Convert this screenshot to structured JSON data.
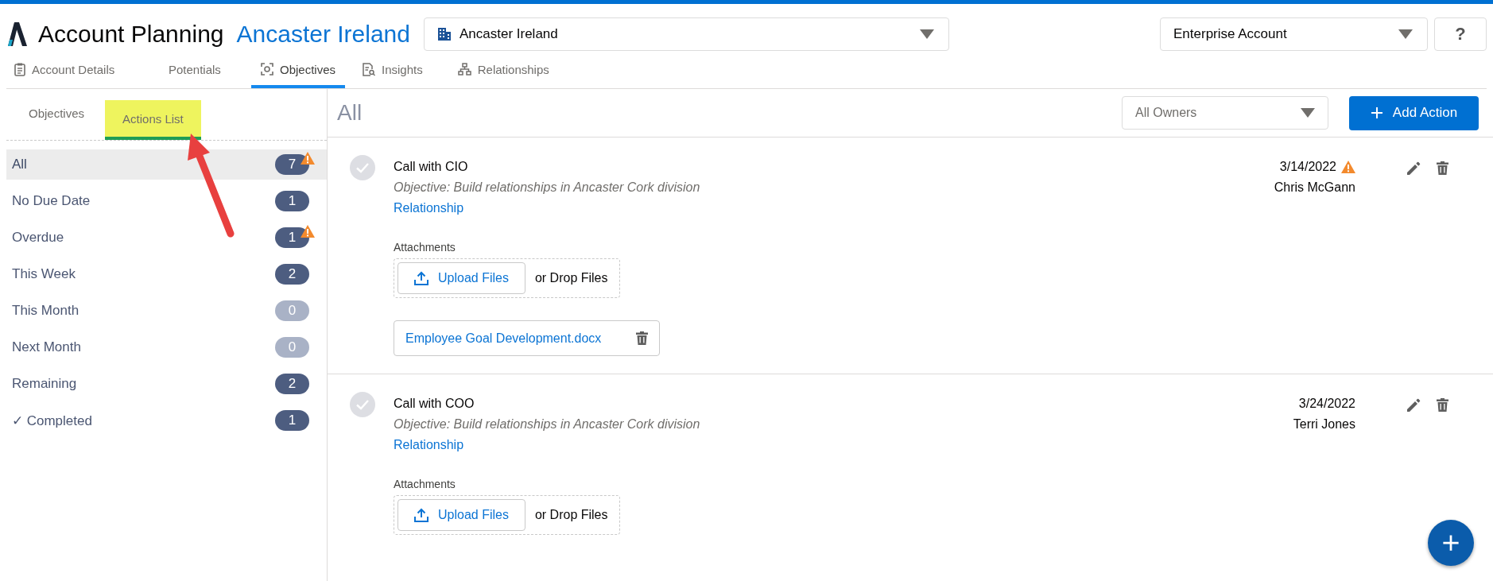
{
  "app": {
    "title": "Account Planning",
    "account": "Ancaster Ireland"
  },
  "account_picker": {
    "value": "Ancaster Ireland"
  },
  "account_type_picker": {
    "value": "Enterprise Account"
  },
  "help_button": {
    "label": "?"
  },
  "tabs": [
    {
      "label": "Account Details",
      "selected": false
    },
    {
      "label": "Potentials",
      "selected": false
    },
    {
      "label": "Objectives",
      "selected": true
    },
    {
      "label": "Insights",
      "selected": false
    },
    {
      "label": "Relationships",
      "selected": false
    }
  ],
  "sub_tabs": [
    {
      "label": "Objectives",
      "selected": false,
      "highlighted": false
    },
    {
      "label": "Actions List",
      "selected": true,
      "highlighted": true
    }
  ],
  "filters": [
    {
      "label": "All",
      "count": "7",
      "selected": true,
      "dimmed": false,
      "warning": true
    },
    {
      "label": "No Due Date",
      "count": "1",
      "selected": false,
      "dimmed": false,
      "warning": false
    },
    {
      "label": "Overdue",
      "count": "1",
      "selected": false,
      "dimmed": false,
      "warning": true
    },
    {
      "label": "This Week",
      "count": "2",
      "selected": false,
      "dimmed": false,
      "warning": false
    },
    {
      "label": "This Month",
      "count": "0",
      "selected": false,
      "dimmed": true,
      "warning": false
    },
    {
      "label": "Next Month",
      "count": "0",
      "selected": false,
      "dimmed": true,
      "warning": false
    },
    {
      "label": "Remaining",
      "count": "2",
      "selected": false,
      "dimmed": false,
      "warning": false
    },
    {
      "label": "✓ Completed",
      "count": "1",
      "selected": false,
      "dimmed": false,
      "warning": false
    }
  ],
  "list": {
    "heading": "All",
    "owner_filter": "All Owners",
    "add_button": "Add Action"
  },
  "actions": [
    {
      "title": "Call with CIO",
      "completed": false,
      "objective": "Objective: Build relationships in Ancaster Cork division",
      "link": "Relationship",
      "date": "3/14/2022",
      "overdue": true,
      "owner": "Chris McGann",
      "attachments_label": "Attachments",
      "upload_label": "Upload Files",
      "drop_label": "or Drop Files",
      "files": [
        "Employee Goal Development.docx"
      ]
    },
    {
      "title": "Call with COO",
      "completed": false,
      "objective": "Objective: Build relationships in Ancaster Cork division",
      "link": "Relationship",
      "date": "3/24/2022",
      "overdue": false,
      "owner": "Terri Jones",
      "attachments_label": "Attachments",
      "upload_label": "Upload Files",
      "drop_label": "or Drop Files"
    }
  ]
}
